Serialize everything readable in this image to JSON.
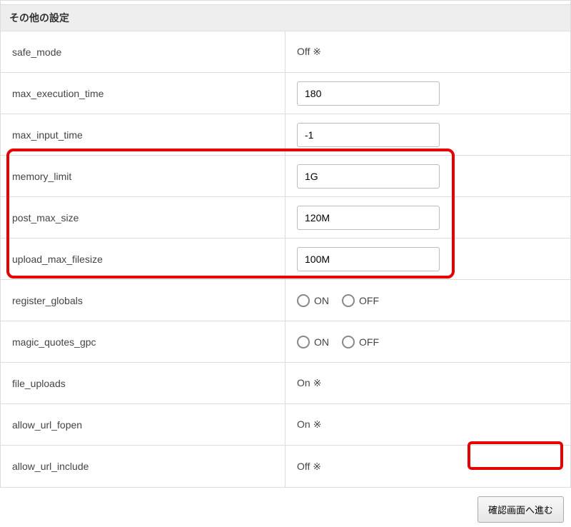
{
  "section": {
    "title": "その他の設定"
  },
  "rows": {
    "safe_mode": {
      "label": "safe_mode",
      "value": "Off ※"
    },
    "max_execution_time": {
      "label": "max_execution_time",
      "value": "180"
    },
    "max_input_time": {
      "label": "max_input_time",
      "value": "-1"
    },
    "memory_limit": {
      "label": "memory_limit",
      "value": "1G"
    },
    "post_max_size": {
      "label": "post_max_size",
      "value": "120M"
    },
    "upload_max_filesize": {
      "label": "upload_max_filesize",
      "value": "100M"
    },
    "register_globals": {
      "label": "register_globals",
      "on": "ON",
      "off": "OFF"
    },
    "magic_quotes_gpc": {
      "label": "magic_quotes_gpc",
      "on": "ON",
      "off": "OFF"
    },
    "file_uploads": {
      "label": "file_uploads",
      "value": "On ※"
    },
    "allow_url_fopen": {
      "label": "allow_url_fopen",
      "value": "On ※"
    },
    "allow_url_include": {
      "label": "allow_url_include",
      "value": "Off ※"
    }
  },
  "actions": {
    "confirm": "確認画面へ進む"
  }
}
